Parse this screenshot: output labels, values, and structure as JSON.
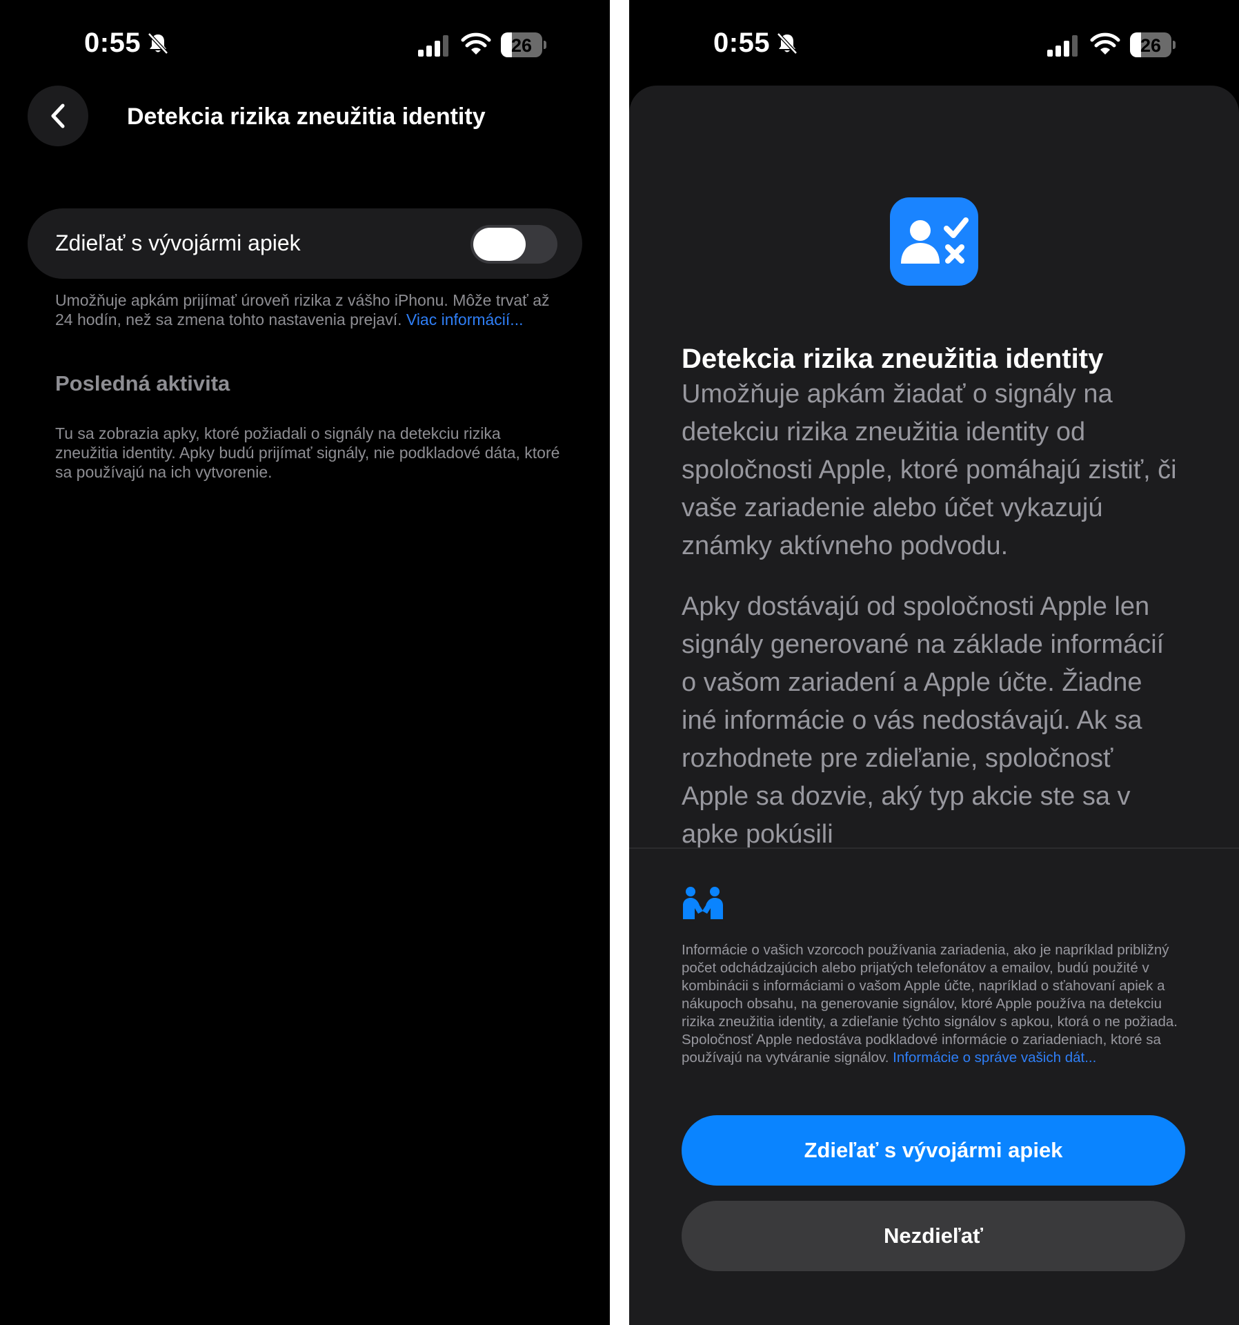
{
  "left_screen": {
    "status_bar": {
      "time": "0:55",
      "battery": "26",
      "battery_fraction": 0.26
    },
    "nav": {
      "title": "Detekcia rizika zneužitia identity"
    },
    "toggle": {
      "label": "Zdieľať s vývojármi apiek",
      "state": "off"
    },
    "description": {
      "text": "Umožňuje apkám prijímať úroveň rizika z vášho iPhonu. Môže trvať až 24 hodín, než sa zmena tohto nastavenia prejaví. ",
      "link": "Viac informácií..."
    },
    "recent_activity": {
      "header": "Posledná aktivita",
      "text": "Tu sa zobrazia apky, ktoré požiadali o signály na detekciu rizika zneužitia identity. Apky budú prijímať signály, nie podkladové dáta, ktoré sa používajú na ich vytvorenie."
    }
  },
  "right_screen": {
    "status_bar": {
      "time": "0:55",
      "battery": "26",
      "battery_fraction": 0.26
    },
    "sheet": {
      "title": "Detekcia rizika zneužitia identity",
      "paragraph1": "Umožňuje apkám žiadať o signály na detekciu rizika zneužitia identity od spoločnosti Apple, ktoré pomáhajú zistiť, či vaše zariadenie alebo účet vykazujú známky aktívneho podvodu.",
      "paragraph2": "Apky dostávajú od spoločnosti Apple len signály generované na základe informácií o vašom zariadení a Apple účte. Žiadne iné informácie o vás nedostávajú. Ak sa rozhodnete pre zdieľanie, spoločnosť Apple sa dozvie, aký typ akcie ste sa v apke pokúsili",
      "privacy_text": "Informácie o vašich vzorcoch používania zariadenia, ako je napríklad približný počet odchádzajúcich alebo prijatých telefonátov a emailov, budú použité v kombinácii s informáciami o vašom Apple účte, napríklad o sťahovaní apiek a nákupoch obsahu, na generovanie signálov, ktoré Apple používa na detekciu rizika zneužitia identity, a zdieľanie týchto signálov s apkou, ktorá o ne požiada. Spoločnosť Apple nedostáva podkladové informácie o zariadeniach, ktoré sa používajú na vytváranie signálov. ",
      "privacy_link": "Informácie o správe vašich dát...",
      "primary_button": "Zdieľať s vývojármi apiek",
      "secondary_button": "Nezdieľať"
    }
  },
  "colors": {
    "accent_blue": "#0a84ff",
    "link_blue": "#2f7ff7",
    "background": "#000000",
    "surface": "#1c1c1e",
    "secondary_text": "#8e8e93"
  },
  "icons": [
    "bell-slash-icon",
    "cellular-signal-icon",
    "wifi-icon",
    "battery-icon",
    "chevron-left-icon",
    "identity-check-icon",
    "privacy-handshake-icon"
  ]
}
